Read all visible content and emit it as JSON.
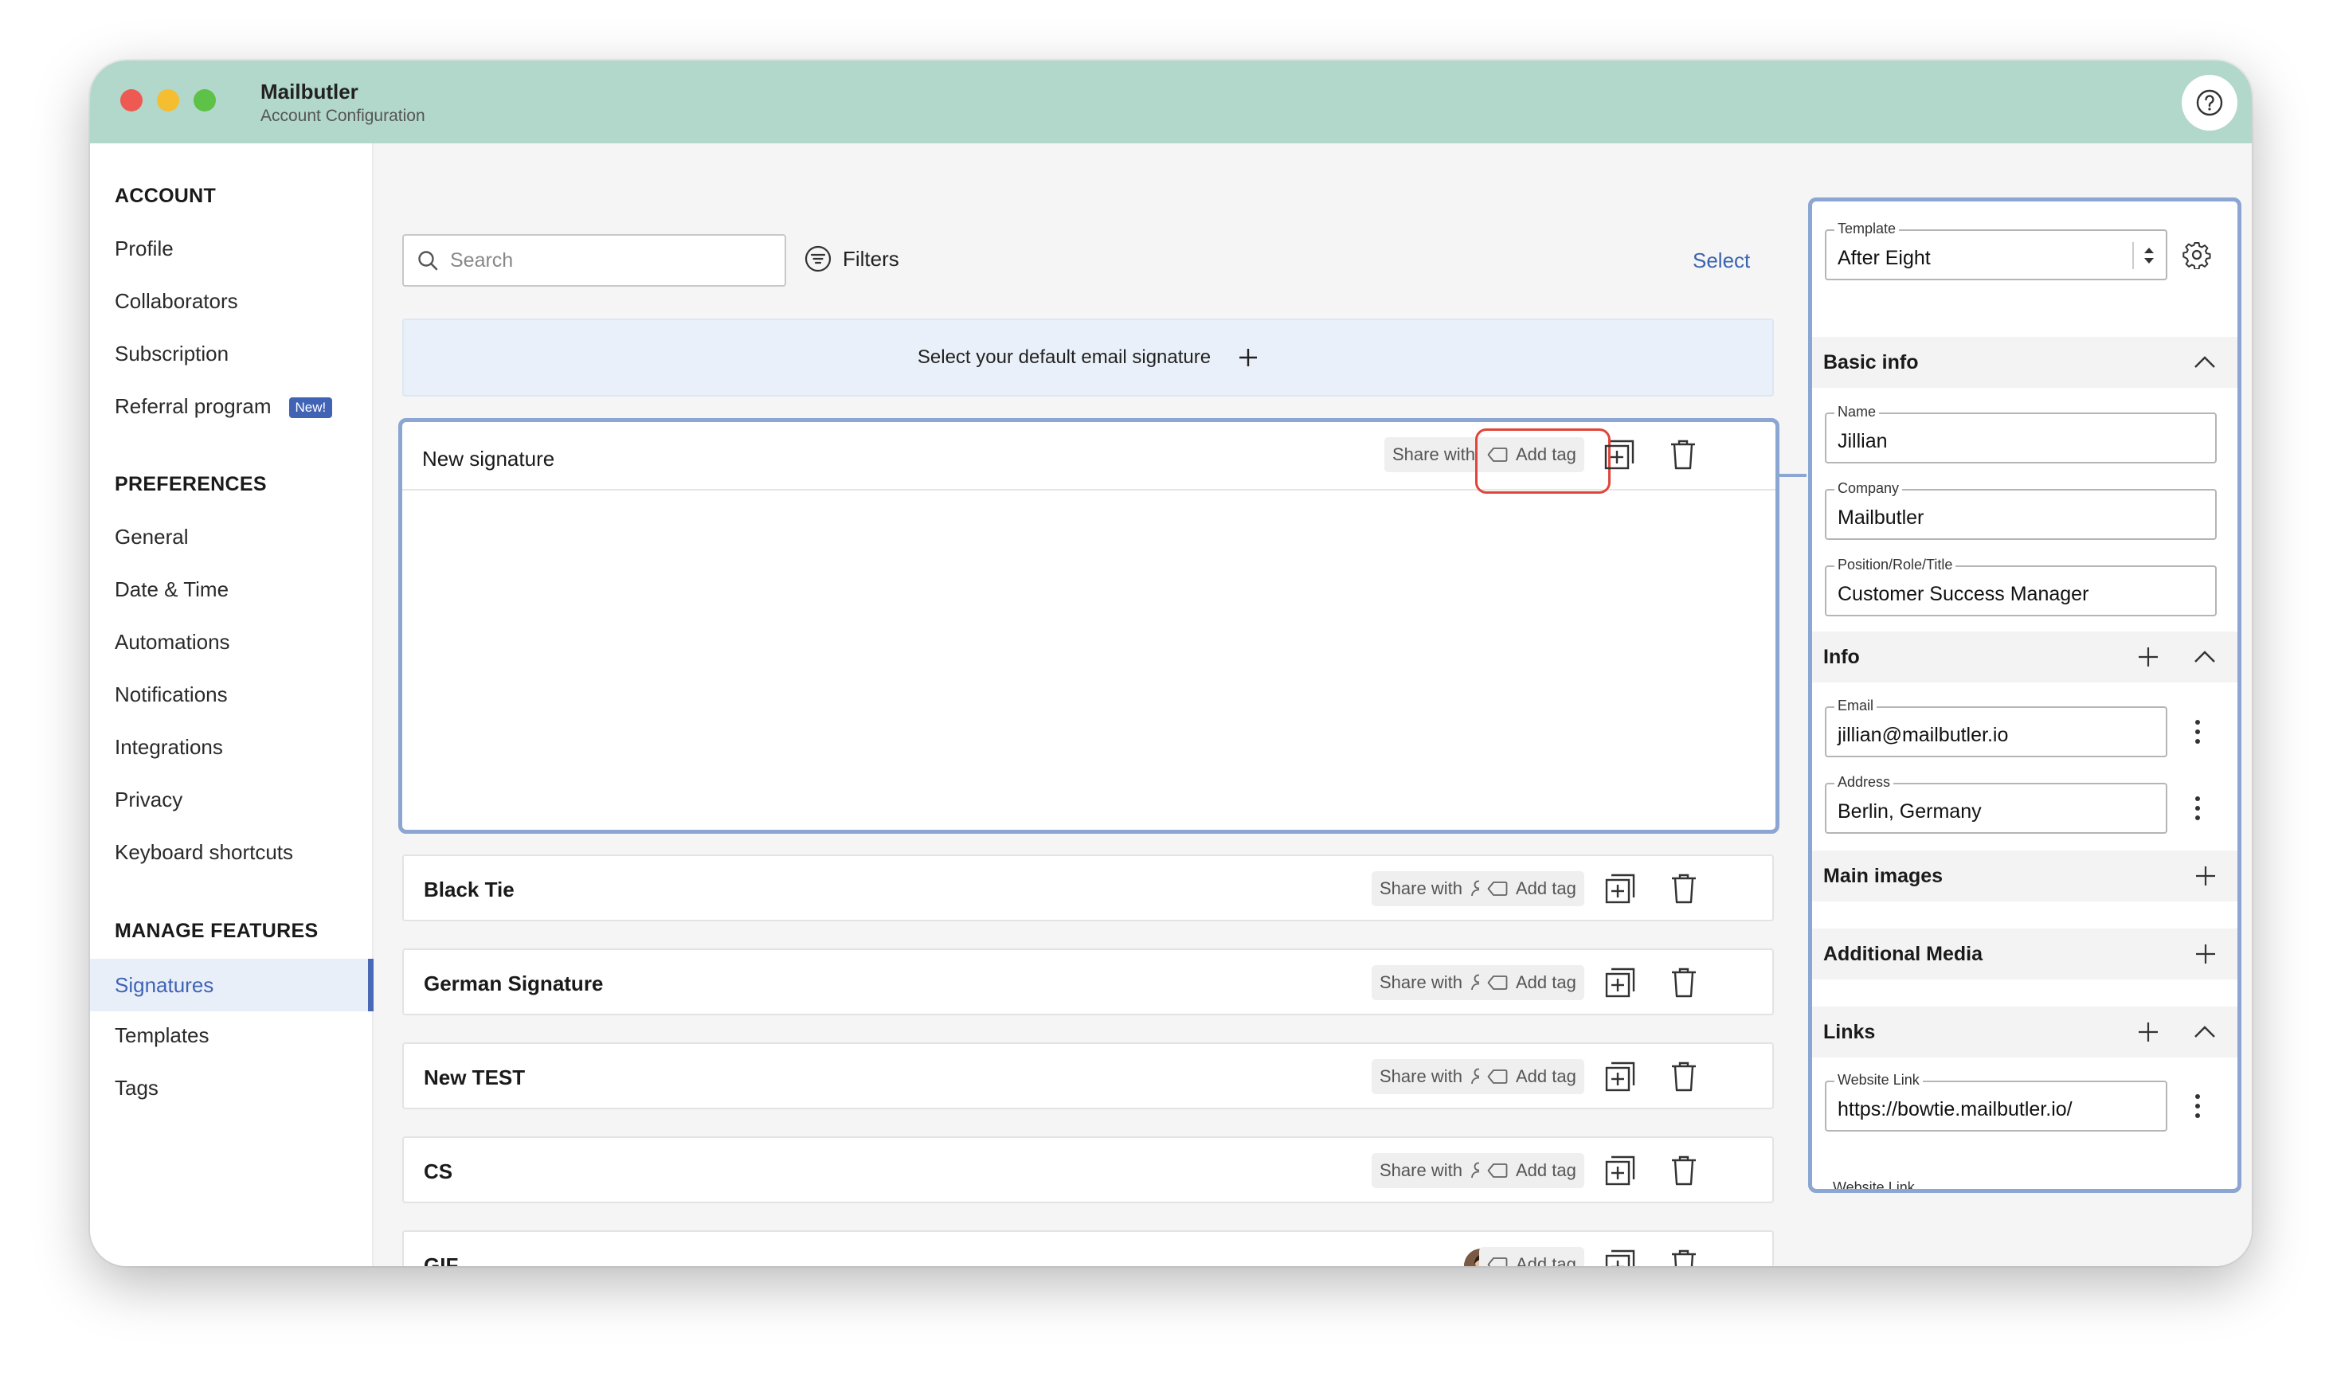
{
  "window": {
    "title": "Mailbutler",
    "subtitle": "Account Configuration"
  },
  "sidebar": {
    "sections": [
      {
        "heading": "ACCOUNT",
        "items": [
          {
            "label": "Profile"
          },
          {
            "label": "Collaborators"
          },
          {
            "label": "Subscription"
          },
          {
            "label": "Referral program",
            "badge": "New!"
          }
        ]
      },
      {
        "heading": "PREFERENCES",
        "items": [
          {
            "label": "General"
          },
          {
            "label": "Date & Time"
          },
          {
            "label": "Automations"
          },
          {
            "label": "Notifications"
          },
          {
            "label": "Integrations"
          },
          {
            "label": "Privacy"
          },
          {
            "label": "Keyboard shortcuts"
          }
        ]
      },
      {
        "heading": "MANAGE FEATURES",
        "items": [
          {
            "label": "Signatures",
            "active": true
          },
          {
            "label": "Templates"
          },
          {
            "label": "Tags"
          }
        ]
      }
    ]
  },
  "toolbar": {
    "search_placeholder": "Search",
    "filters_label": "Filters",
    "select_label": "Select"
  },
  "default_bar": {
    "text": "Select your default email signature"
  },
  "signatures": [
    {
      "name": "New signature",
      "share_label": "Share with",
      "tag_label": "Add tag",
      "expanded": true
    },
    {
      "name": "Black Tie",
      "share_label": "Share with",
      "tag_label": "Add tag"
    },
    {
      "name": "German Signature",
      "share_label": "Share with",
      "tag_label": "Add tag"
    },
    {
      "name": "New TEST",
      "share_label": "Share with",
      "tag_label": "Add tag"
    },
    {
      "name": "CS",
      "share_label": "Share with",
      "tag_label": "Add tag"
    },
    {
      "name": "GIF",
      "tag_label": "Add tag",
      "shared_avatar": true
    }
  ],
  "editor": {
    "template": {
      "label": "Template",
      "value": "After Eight"
    },
    "basic_info": {
      "title": "Basic info",
      "fields": [
        {
          "label": "Name",
          "value": "Jillian"
        },
        {
          "label": "Company",
          "value": "Mailbutler"
        },
        {
          "label": "Position/Role/Title",
          "value": "Customer Success Manager"
        }
      ]
    },
    "info": {
      "title": "Info",
      "fields": [
        {
          "label": "Email",
          "value": "jillian@mailbutler.io"
        },
        {
          "label": "Address",
          "value": "Berlin, Germany"
        }
      ]
    },
    "main_images": {
      "title": "Main images"
    },
    "additional_media": {
      "title": "Additional Media"
    },
    "links": {
      "title": "Links",
      "fields": [
        {
          "label": "Website Link",
          "value": "https://bowtie.mailbutler.io/"
        },
        {
          "label": "Website Link"
        }
      ]
    }
  },
  "colors": {
    "titlebar": "#b1d8ca",
    "accent": "#4562b3",
    "selection_border": "#8ba6d2",
    "highlight": "#e0453a"
  }
}
